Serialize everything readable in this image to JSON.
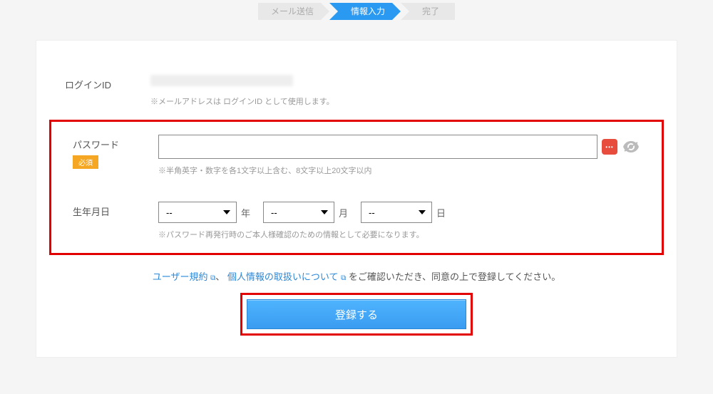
{
  "stepper": {
    "step1": "メール送信",
    "step2": "情報入力",
    "step3": "完了"
  },
  "loginId": {
    "label": "ログインID",
    "hint": "※メールアドレスは ログインID として使用します。"
  },
  "password": {
    "label": "パスワード",
    "required": "必須",
    "value": "",
    "hint": "※半角英字・数字を各1文字以上含む、8文字以上20文字以内"
  },
  "birth": {
    "label": "生年月日",
    "yearValue": "--",
    "yearUnit": "年",
    "monthValue": "--",
    "monthUnit": "月",
    "dayValue": "--",
    "dayUnit": "日",
    "hint": "※パスワード再発行時のご本人様確認のための情報として必要になります。"
  },
  "agree": {
    "termsLink": "ユーザー規約",
    "sep": "、",
    "privacyLink": "個人情報の取扱いについて",
    "tail": " をご確認いただき、同意の上で登録してください。"
  },
  "submit": {
    "label": "登録する"
  }
}
